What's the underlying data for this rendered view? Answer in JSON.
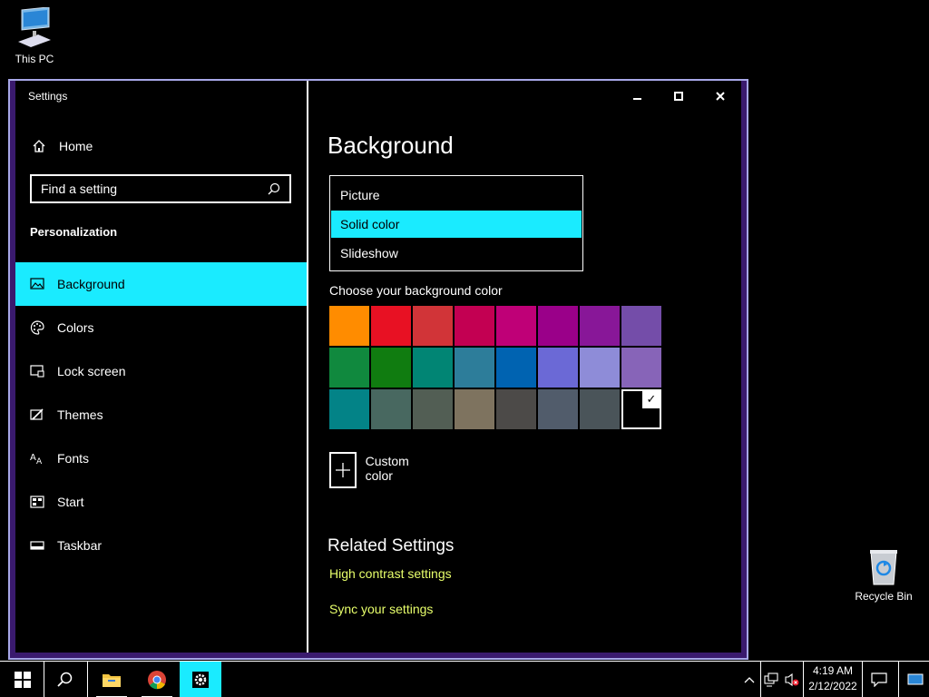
{
  "desktop": {
    "this_pc_label": "This PC",
    "recycle_bin_label": "Recycle Bin"
  },
  "window": {
    "title": "Settings",
    "controls": {
      "minimize": "minimize-icon",
      "maximize": "maximize-icon",
      "close": "close-icon"
    }
  },
  "sidebar": {
    "home_label": "Home",
    "search_placeholder": "Find a setting",
    "section_title": "Personalization",
    "items": [
      {
        "label": "Background",
        "icon": "picture-icon",
        "active": true
      },
      {
        "label": "Colors",
        "icon": "palette-icon",
        "active": false
      },
      {
        "label": "Lock screen",
        "icon": "lock-screen-icon",
        "active": false
      },
      {
        "label": "Themes",
        "icon": "themes-icon",
        "active": false
      },
      {
        "label": "Fonts",
        "icon": "fonts-icon",
        "active": false
      },
      {
        "label": "Start",
        "icon": "start-icon",
        "active": false
      },
      {
        "label": "Taskbar",
        "icon": "taskbar-icon",
        "active": false
      }
    ]
  },
  "main": {
    "title": "Background",
    "background_options": [
      "Picture",
      "Solid color",
      "Slideshow"
    ],
    "selected_option": "Solid color",
    "color_label": "Choose your background color",
    "colors": [
      "#ff8c00",
      "#e81123",
      "#d13438",
      "#c30052",
      "#bf0077",
      "#9a0089",
      "#881798",
      "#744da9",
      "#10893e",
      "#107c10",
      "#018574",
      "#2d7d9a",
      "#0063b1",
      "#6b69d6",
      "#8e8cd8",
      "#8764b8",
      "#038387",
      "#486860",
      "#525e54",
      "#7e735f",
      "#4c4a48",
      "#515c6b",
      "#4a5459",
      "#000000"
    ],
    "selected_color": "#000000",
    "custom_color_label": "Custom color",
    "related_title": "Related Settings",
    "links": [
      "High contrast settings",
      "Sync your settings"
    ]
  },
  "taskbar": {
    "time": "4:19 AM",
    "date": "2/12/2022",
    "apps": [
      "start-icon",
      "search-icon",
      "file-explorer-icon",
      "chrome-icon",
      "settings-gear-icon"
    ]
  },
  "colors": {
    "accent": "#1aebff",
    "link": "#e8ff6b",
    "window_border": "#a7a7e8",
    "frame": "#3a1a6e"
  }
}
